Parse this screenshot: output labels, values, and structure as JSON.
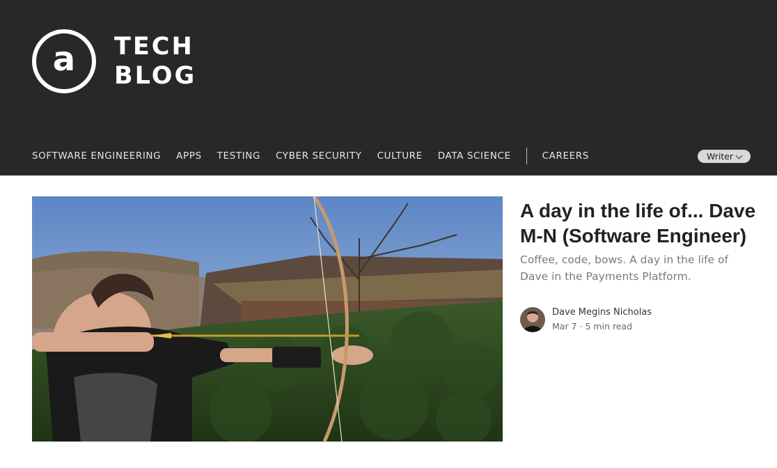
{
  "header": {
    "logo_symbol": "a",
    "logo_line1": "TECH",
    "logo_line2": "BLOG",
    "background": "#282828"
  },
  "nav": {
    "items": [
      {
        "label": "SOFTWARE ENGINEERING"
      },
      {
        "label": "APPS"
      },
      {
        "label": "TESTING"
      },
      {
        "label": "CYBER SECURITY"
      },
      {
        "label": "CULTURE"
      },
      {
        "label": "DATA SCIENCE"
      },
      {
        "label": "CAREERS"
      }
    ]
  },
  "writer_button": {
    "label": "Writer",
    "icon": "chevron-down-icon"
  },
  "article": {
    "title": "A day in the life of... Dave M-N (Software Engineer)",
    "subtitle": "Coffee, code, bows. A day in the life of Dave in the Payments Platform.",
    "author": "Dave Megins Nicholas",
    "date": "Mar 7",
    "separator": "·",
    "read_time": "5 min read"
  }
}
